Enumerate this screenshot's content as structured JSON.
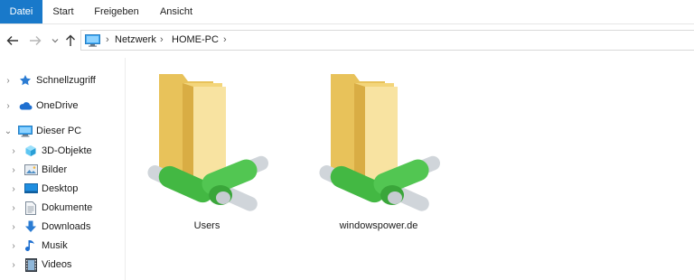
{
  "ribbon": {
    "tabs": [
      {
        "label": "Datei"
      },
      {
        "label": "Start"
      },
      {
        "label": "Freigeben"
      },
      {
        "label": "Ansicht"
      }
    ]
  },
  "address": {
    "breadcrumbs": [
      "Netzwerk",
      "HOME-PC"
    ]
  },
  "nav": {
    "quick_access": "Schnellzugriff",
    "onedrive": "OneDrive",
    "this_pc": "Dieser PC",
    "children": [
      {
        "label": "3D-Objekte",
        "icon": "3d-objects-icon"
      },
      {
        "label": "Bilder",
        "icon": "pictures-icon"
      },
      {
        "label": "Desktop",
        "icon": "desktop-icon"
      },
      {
        "label": "Dokumente",
        "icon": "documents-icon"
      },
      {
        "label": "Downloads",
        "icon": "downloads-icon"
      },
      {
        "label": "Musik",
        "icon": "music-icon"
      },
      {
        "label": "Videos",
        "icon": "videos-icon"
      }
    ]
  },
  "content": {
    "items": [
      {
        "label": "Users",
        "icon": "shared-folder-icon"
      },
      {
        "label": "windowspower.de",
        "icon": "shared-folder-icon"
      }
    ]
  },
  "colors": {
    "accent": "#1979ca",
    "folder": "#f6d77c",
    "pipe_green": "#4cc04c"
  }
}
